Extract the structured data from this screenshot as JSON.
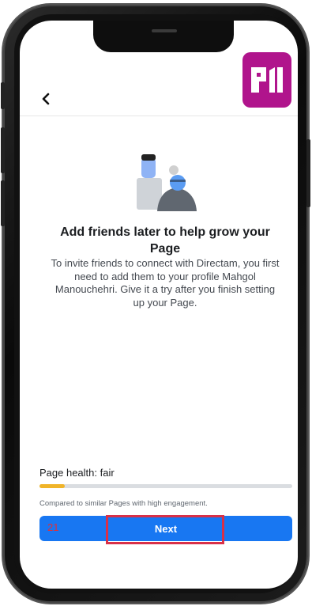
{
  "header": {
    "back_icon": "chevron-left-icon",
    "logo_icon": "brand-logo-icon",
    "logo_color": "#b0148c"
  },
  "main": {
    "illustration_icon": "add-friends-illustration-icon",
    "headline": "Add friends later to help grow your Page",
    "body": "To invite friends to connect with Directam, you first need to add them to your profile Mahgol Manouchehri. Give it a try after you finish setting up your Page."
  },
  "footer": {
    "health_label": "Page health: fair",
    "health_progress": 0.1,
    "health_color": "#f0b429",
    "compare_text": "Compared to similar Pages with high engagement.",
    "next_label": "Next",
    "next_color": "#1877f2",
    "step_number": "21",
    "highlight_color": "#d93048"
  }
}
